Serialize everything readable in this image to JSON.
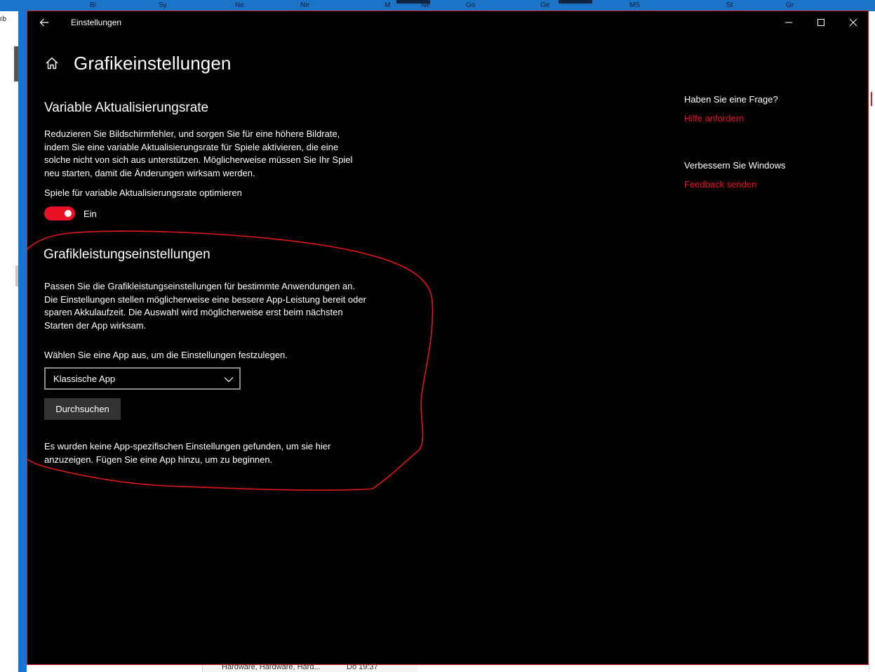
{
  "window": {
    "title": "Einstellungen",
    "accent_color": "#e81123"
  },
  "page": {
    "title": "Grafikeinstellungen"
  },
  "vrr": {
    "title": "Variable Aktualisierungsrate",
    "description": "Reduzieren Sie Bildschirmfehler, und sorgen Sie für eine höhere Bildrate, indem Sie eine variable Aktualisierungsrate für Spiele aktivieren, die eine solche nicht von sich aus unterstützen. Möglicherweise müssen Sie Ihr Spiel neu starten, damit die Änderungen wirksam werden.",
    "toggle_label": "Spiele für variable Aktualisierungsrate optimieren",
    "toggle_state": "Ein",
    "toggle_on": true
  },
  "performance": {
    "title": "Grafikleistungseinstellungen",
    "description": "Passen Sie die Grafikleistungseinstellungen für bestimmte Anwendungen an. Die Einstellungen stellen möglicherweise eine bessere App-Leistung bereit oder sparen Akkulaufzeit. Die Auswahl wird möglicherweise erst beim nächsten Starten der App wirksam.",
    "choose_label": "Wählen Sie eine App aus, um die Einstellungen festzulegen.",
    "app_type": "Klassische App",
    "browse_label": "Durchsuchen",
    "empty_text": "Es wurden keine App-spezifischen Einstellungen gefunden, um sie hier anzuzeigen. Fügen Sie eine App hinzu, um zu beginnen."
  },
  "side_panel": {
    "question_heading": "Haben Sie eine Frage?",
    "help_link": "Hilfe anfordern",
    "improve_heading": "Verbessern Sie Windows",
    "feedback_link": "Feedback senden"
  },
  "background": {
    "top_labels": [
      "Bi",
      "Sy",
      "Ne",
      "Ne",
      "M",
      "Ne",
      "Go",
      "Ge",
      "MS",
      "St",
      "Gr"
    ],
    "left_fragment": "rb",
    "bottom_row_text": "Hardware, Hardware, Hard...",
    "bottom_row_time": "Do 19:37"
  }
}
